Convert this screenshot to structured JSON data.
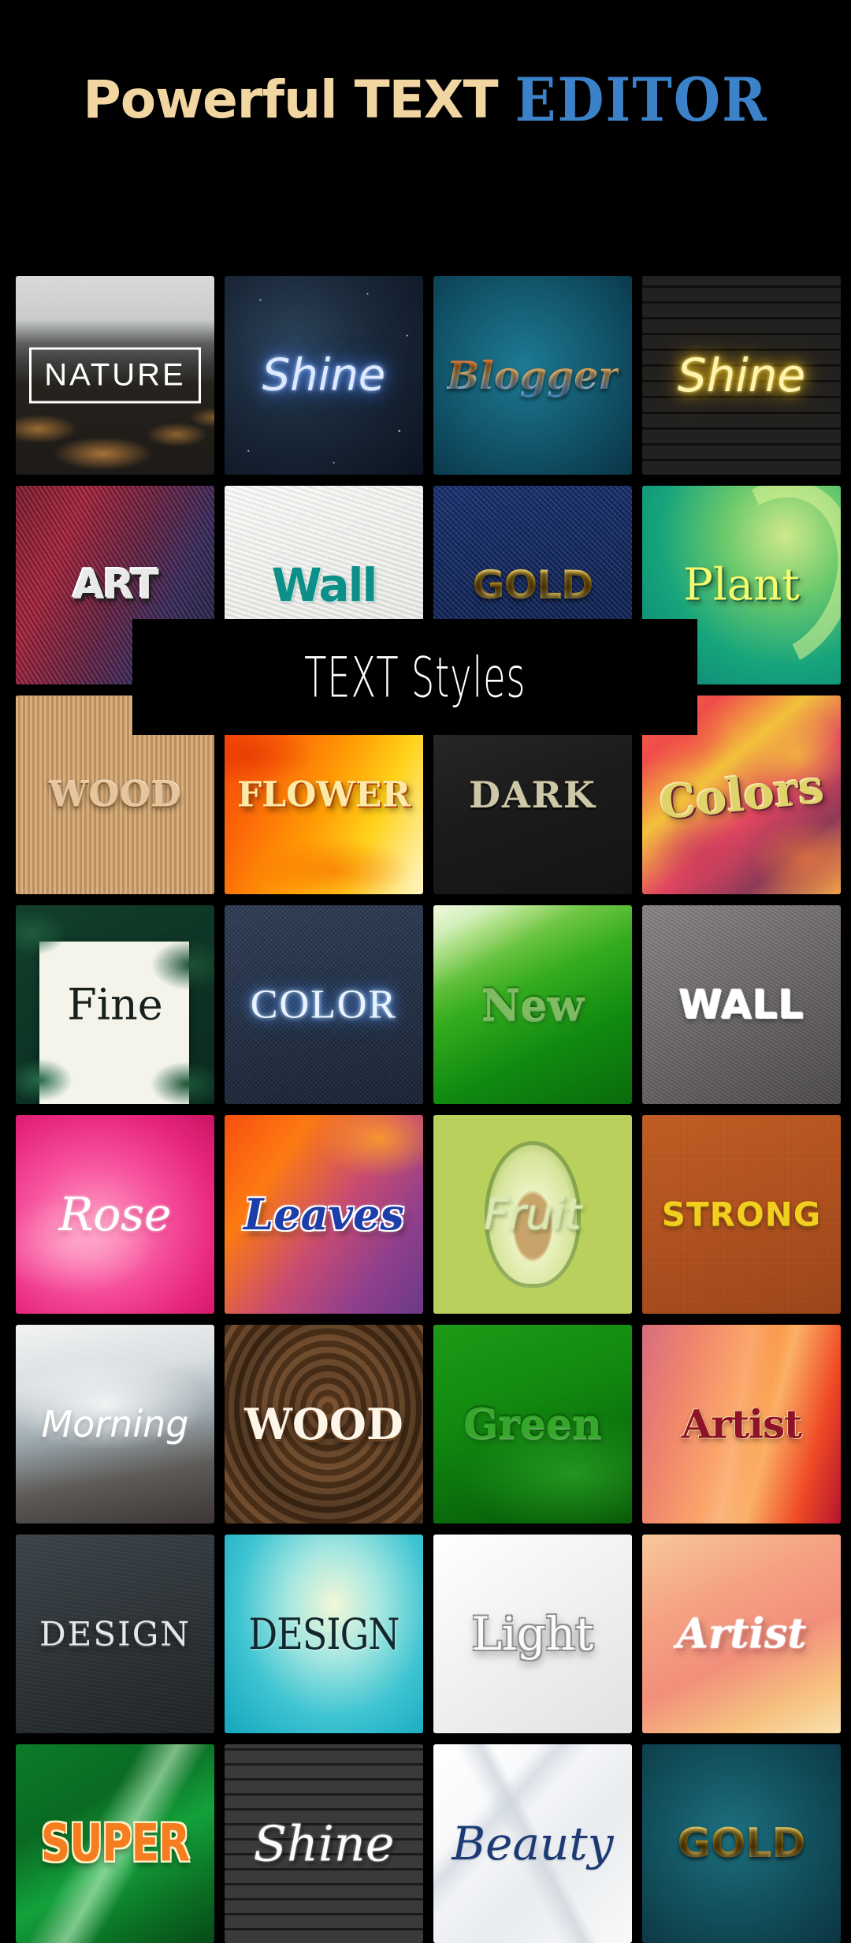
{
  "header": {
    "part1": "Powerful TEXT",
    "part2": "EDITOR",
    "part1_color": "#F2D6A2",
    "part2_color": "#3C82C8"
  },
  "overlay": {
    "label": "TEXT Styles",
    "background_color": "#000000",
    "text_color": "#FFFFFF"
  },
  "background_color": "#000000",
  "grid": {
    "columns": 4,
    "rows_visible": 8,
    "tiles": [
      {
        "label": "NATURE",
        "bg": "bg-nature",
        "style": "t-nature"
      },
      {
        "label": "Shine",
        "bg": "bg-space",
        "style": "t-neonblue"
      },
      {
        "label": "Blogger",
        "bg": "bg-teal",
        "style": "t-blogger"
      },
      {
        "label": "Shine",
        "bg": "bg-brick",
        "style": "t-neonyellow"
      },
      {
        "label": "ART",
        "bg": "bg-feather",
        "style": "t-art"
      },
      {
        "label": "Wall",
        "bg": "bg-plaster",
        "style": "t-wall2"
      },
      {
        "label": "GOLD",
        "bg": "bg-denimblue",
        "style": "t-gold"
      },
      {
        "label": "Plant",
        "bg": "bg-plantgreen",
        "style": "t-plant"
      },
      {
        "label": "WOOD",
        "bg": "bg-woodlight",
        "style": "t-wood1"
      },
      {
        "label": "FLOWER",
        "bg": "bg-flower",
        "style": "t-flower"
      },
      {
        "label": "DARK",
        "bg": "bg-darkcard",
        "style": "t-dark"
      },
      {
        "label": "Colors",
        "bg": "bg-leaves",
        "style": "t-colors"
      },
      {
        "label": "Fine",
        "bg": "bg-finepaper",
        "style": "t-fine"
      },
      {
        "label": "COLOR",
        "bg": "bg-denimdark",
        "style": "t-color"
      },
      {
        "label": "New",
        "bg": "bg-greenleaf",
        "style": "t-new"
      },
      {
        "label": "WALL",
        "bg": "bg-concrete",
        "style": "t-wall"
      },
      {
        "label": "Rose",
        "bg": "bg-rosepink",
        "style": "t-rose"
      },
      {
        "label": "Leaves",
        "bg": "bg-autumnblur",
        "style": "t-leaves"
      },
      {
        "label": "Fruit",
        "bg": "bg-avocado",
        "style": "t-fruit"
      },
      {
        "label": "STRONG",
        "bg": "bg-orangefelt",
        "style": "t-strong"
      },
      {
        "label": "Morning",
        "bg": "bg-morningfog",
        "style": "t-morning"
      },
      {
        "label": "WOOD",
        "bg": "bg-woodknot",
        "style": "t-wood2"
      },
      {
        "label": "Green",
        "bg": "bg-greendark",
        "style": "t-green"
      },
      {
        "label": "Artist",
        "bg": "bg-canyon",
        "style": "t-artist1"
      },
      {
        "label": "DESIGN",
        "bg": "bg-slate",
        "style": "t-design1"
      },
      {
        "label": "DESIGN",
        "bg": "bg-aqua",
        "style": "t-design2"
      },
      {
        "label": "Light",
        "bg": "bg-whitepaper",
        "style": "t-light"
      },
      {
        "label": "Artist",
        "bg": "bg-peach",
        "style": "t-artist2"
      },
      {
        "label": "SUPER",
        "bg": "bg-greenblade",
        "style": "t-super"
      },
      {
        "label": "Shine",
        "bg": "bg-brickgrey",
        "style": "t-shinescript"
      },
      {
        "label": "Beauty",
        "bg": "bg-whitefold",
        "style": "t-beauty"
      },
      {
        "label": "GOLD",
        "bg": "bg-tealdark",
        "style": "t-gold2"
      }
    ]
  }
}
